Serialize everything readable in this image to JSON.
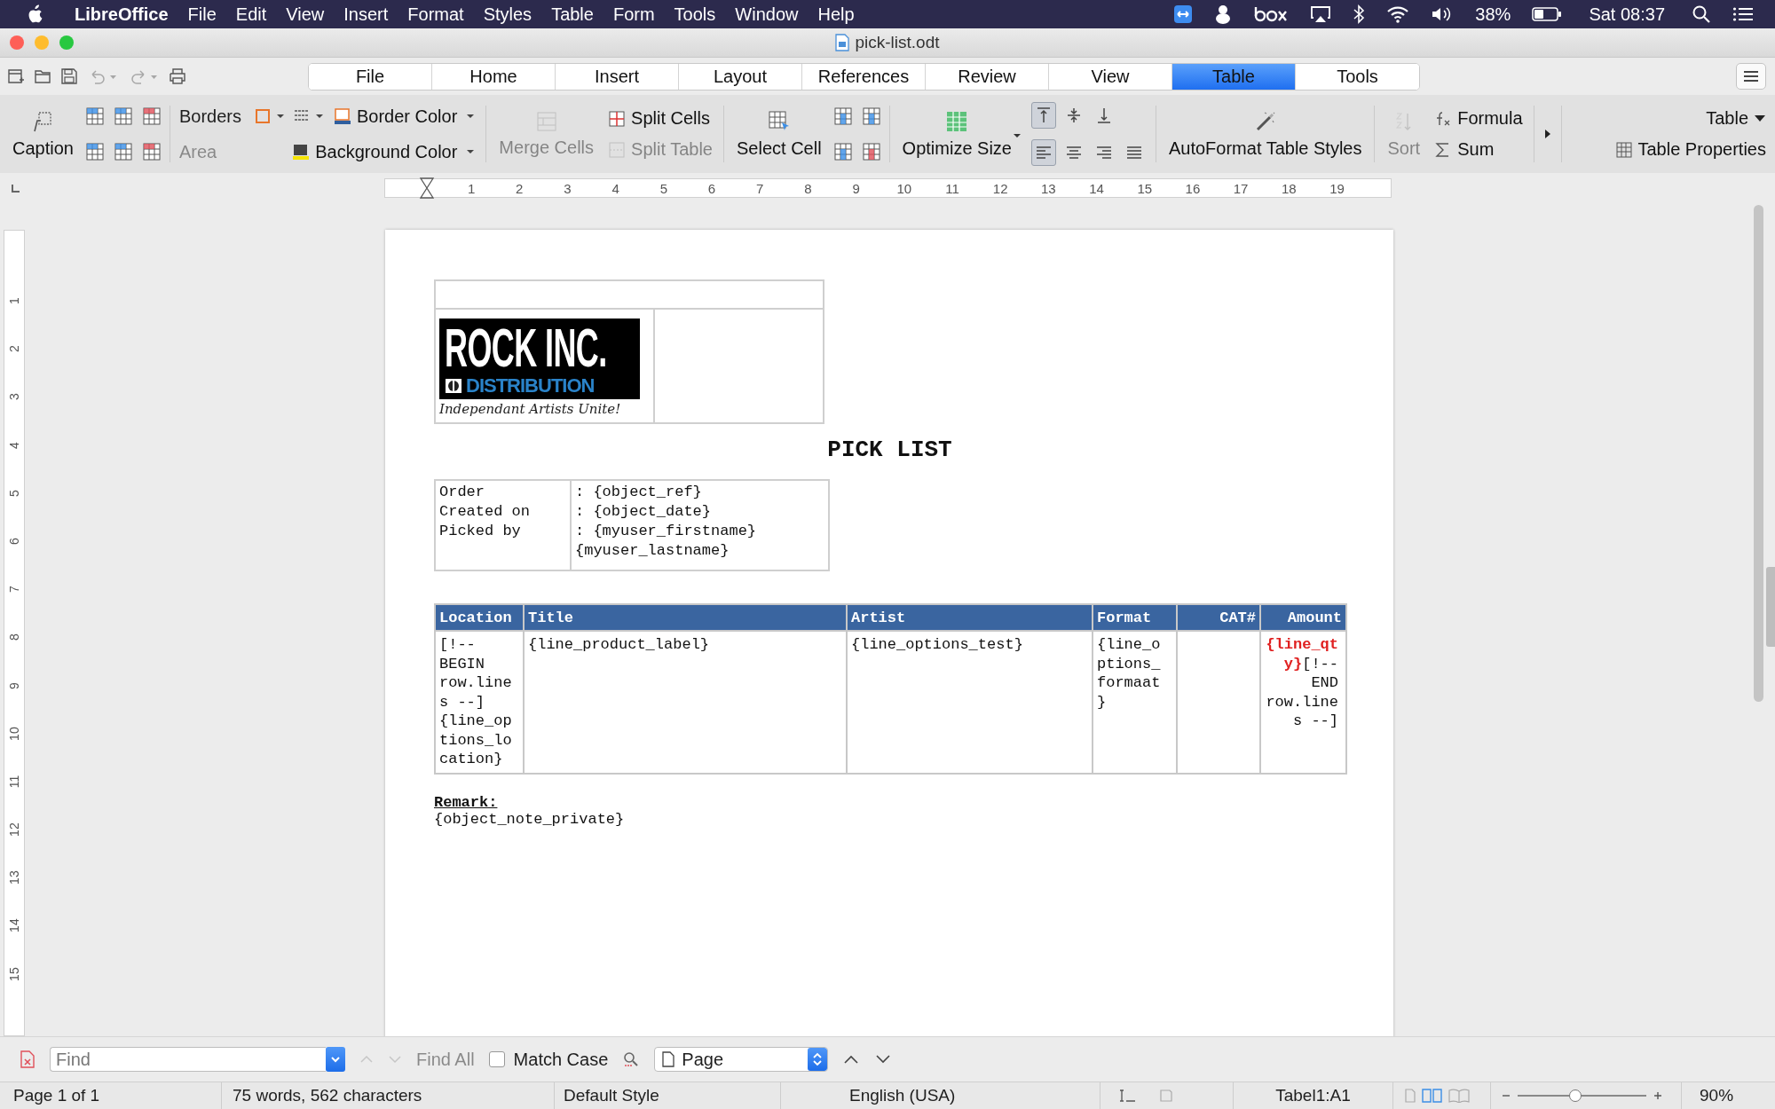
{
  "menubar": {
    "app": "LibreOffice",
    "menus": [
      "File",
      "Edit",
      "View",
      "Insert",
      "Format",
      "Styles",
      "Table",
      "Form",
      "Tools",
      "Window",
      "Help"
    ],
    "battery": "38%",
    "clock": "Sat 08:37"
  },
  "window": {
    "title": "pick-list.odt"
  },
  "quick_toolbar": {
    "undo": {
      "disabled": true
    },
    "redo": {
      "disabled": true
    }
  },
  "tabs": [
    {
      "label": "File",
      "selected": false
    },
    {
      "label": "Home",
      "selected": false
    },
    {
      "label": "Insert",
      "selected": false
    },
    {
      "label": "Layout",
      "selected": false
    },
    {
      "label": "References",
      "selected": false
    },
    {
      "label": "Review",
      "selected": false
    },
    {
      "label": "View",
      "selected": false
    },
    {
      "label": "Table",
      "selected": true
    },
    {
      "label": "Tools",
      "selected": false
    }
  ],
  "ribbon": {
    "caption": {
      "label": "Caption"
    },
    "borders": {
      "label": "Borders"
    },
    "border_color": {
      "label": "Border Color"
    },
    "area": {
      "label": "Area",
      "disabled": true
    },
    "background_color": {
      "label": "Background Color"
    },
    "merge_cells": {
      "label": "Merge Cells",
      "disabled": true
    },
    "split_cells": {
      "label": "Split Cells",
      "disabled": false
    },
    "split_table": {
      "label": "Split Table",
      "disabled": true
    },
    "select_cell": {
      "label": "Select Cell"
    },
    "optimize_size": {
      "label": "Optimize Size"
    },
    "vertical_align": [
      {
        "selected": true
      },
      {
        "selected": false
      },
      {
        "selected": false
      }
    ],
    "horizontal_align": [
      {
        "selected": true
      },
      {
        "selected": false
      },
      {
        "selected": false
      },
      {
        "selected": false
      }
    ],
    "autoformat": {
      "label": "AutoFormat Table Styles"
    },
    "sort": {
      "label": "Sort",
      "disabled": true
    },
    "formula": {
      "label": "Formula"
    },
    "sum": {
      "label": "Sum"
    },
    "table_menu": {
      "label": "Table"
    },
    "table_properties": {
      "label": "Table Properties"
    }
  },
  "ruler": [
    "1",
    "2",
    "3",
    "4",
    "5",
    "6",
    "7",
    "8",
    "9",
    "10",
    "11",
    "12",
    "13",
    "14",
    "15",
    "16",
    "17",
    "18",
    "19"
  ],
  "vertical_ruler": [
    "1",
    "2",
    "3",
    "4",
    "5",
    "6",
    "7",
    "8",
    "9",
    "10",
    "11",
    "12",
    "13",
    "14",
    "15"
  ],
  "document": {
    "logo": {
      "name": "ROCK INC.",
      "subtitle": "DISTRIBUTION",
      "tagline": "Independant Artists Unite!"
    },
    "heading": "PICK LIST",
    "info": [
      {
        "label": "Order",
        "value": ": {object_ref}"
      },
      {
        "label": "Created on",
        "value": ": {object_date}"
      },
      {
        "label": "Picked by",
        "value": ": {myuser_firstname} {myuser_lastname}"
      }
    ],
    "lines_table": {
      "columns": [
        "Location",
        "Title",
        "Artist",
        "Format",
        "CAT#",
        "Amount"
      ],
      "row": {
        "location": "[!-- BEGIN row.lines --] {line_options_location}",
        "title": "{line_product_label}",
        "artist": "{line_options_test}",
        "format": "{line_options_formaat}",
        "qty": "{line_qty}",
        "qty_tail": "[!-- END row.lines --]"
      }
    },
    "remark": {
      "label": "Remark:",
      "value": "{object_note_private}"
    }
  },
  "find_bar": {
    "placeholder": "Find",
    "find_all": "Find All",
    "match_case": {
      "label": "Match Case",
      "checked": false
    },
    "navigate": "Page"
  },
  "status_bar": {
    "page": "Page 1 of 1",
    "words": "75 words, 562 characters",
    "style": "Default Style",
    "language": "English (USA)",
    "cell": "Tabel1:A1",
    "zoom": {
      "level": 0.45,
      "reading": "90%"
    }
  }
}
